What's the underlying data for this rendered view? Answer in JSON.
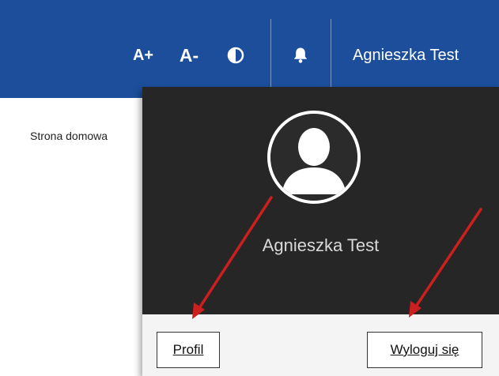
{
  "topbar": {
    "font_increase_label": "A+",
    "font_decrease_label": "A-",
    "user_name": "Agnieszka Test",
    "color": "#1c4e9c"
  },
  "breadcrumb": {
    "home_label": "Strona domowa"
  },
  "user_menu": {
    "user_name": "Agnieszka Test",
    "profile_label": "Profil",
    "logout_label": "Wyloguj się",
    "background_color": "#262626"
  },
  "annotations": {
    "arrow_color": "#cc1f1f"
  }
}
